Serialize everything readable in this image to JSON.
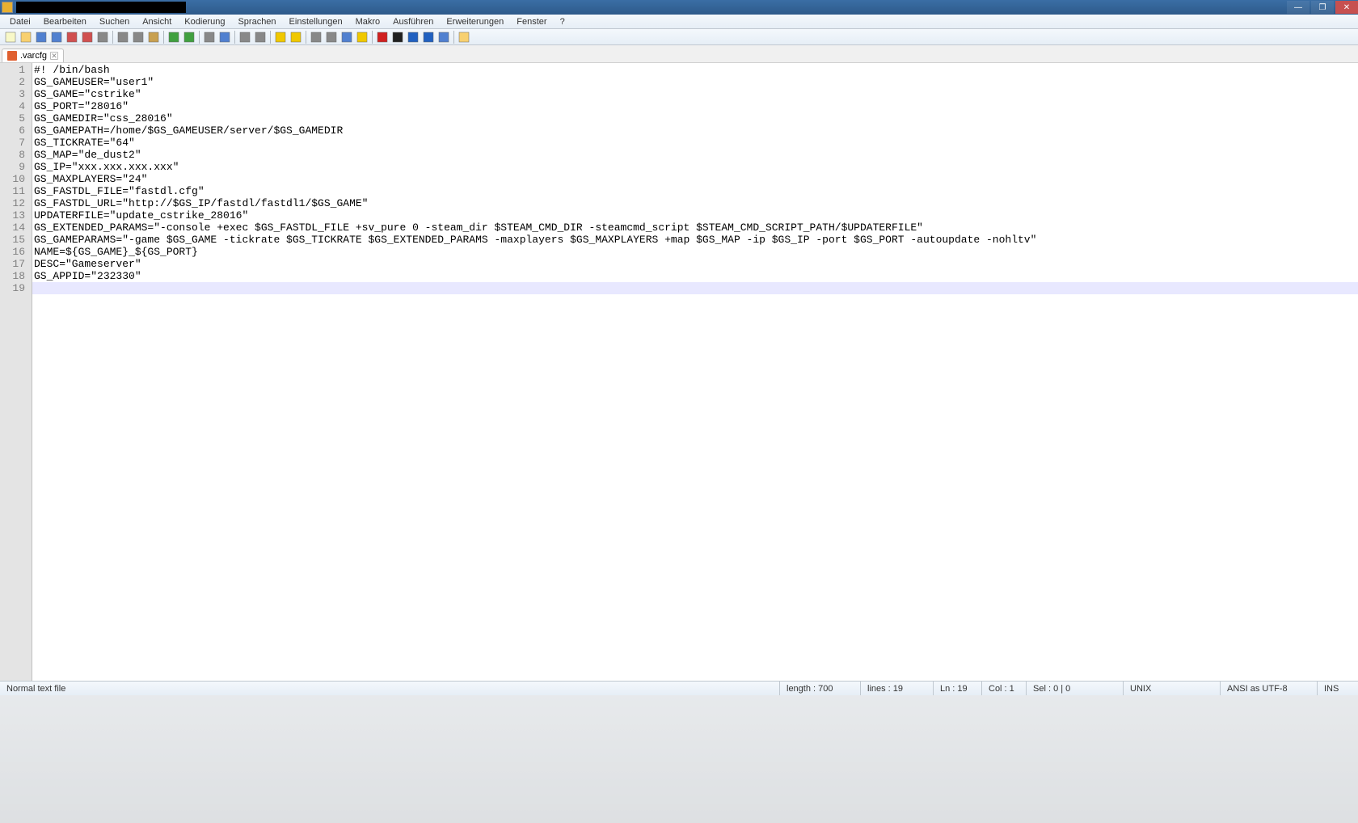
{
  "window": {
    "minimize": "—",
    "maximize": "❐",
    "close": "✕"
  },
  "menu": {
    "items": [
      "Datei",
      "Bearbeiten",
      "Suchen",
      "Ansicht",
      "Kodierung",
      "Sprachen",
      "Einstellungen",
      "Makro",
      "Ausführen",
      "Erweiterungen",
      "Fenster",
      "?"
    ]
  },
  "toolbar": {
    "icons": [
      "new-file-icon",
      "open-file-icon",
      "save-icon",
      "save-all-icon",
      "close-icon",
      "close-all-icon",
      "print-icon",
      "sep",
      "cut-icon",
      "copy-icon",
      "paste-icon",
      "sep",
      "undo-icon",
      "redo-icon",
      "sep",
      "find-icon",
      "replace-icon",
      "sep",
      "zoom-in-icon",
      "zoom-out-icon",
      "sep",
      "sync-v-icon",
      "sync-h-icon",
      "sep",
      "wordwrap-icon",
      "all-chars-icon",
      "indent-icon",
      "lang-icon",
      "sep",
      "record-icon",
      "stop-icon",
      "play-icon",
      "play-multi-icon",
      "save-macro-icon",
      "sep",
      "folder-icon"
    ]
  },
  "tabs": [
    {
      "label": ".varcfg",
      "close": "✕"
    }
  ],
  "code": {
    "lines": [
      "#! /bin/bash",
      "GS_GAMEUSER=\"user1\"",
      "GS_GAME=\"cstrike\"",
      "GS_PORT=\"28016\"",
      "GS_GAMEDIR=\"css_28016\"",
      "GS_GAMEPATH=/home/$GS_GAMEUSER/server/$GS_GAMEDIR",
      "GS_TICKRATE=\"64\"",
      "GS_MAP=\"de_dust2\"",
      "GS_IP=\"xxx.xxx.xxx.xxx\"",
      "GS_MAXPLAYERS=\"24\"",
      "GS_FASTDL_FILE=\"fastdl.cfg\"",
      "GS_FASTDL_URL=\"http://$GS_IP/fastdl/fastdl1/$GS_GAME\"",
      "UPDATERFILE=\"update_cstrike_28016\"",
      "GS_EXTENDED_PARAMS=\"-console +exec $GS_FASTDL_FILE +sv_pure 0 -steam_dir $STEAM_CMD_DIR -steamcmd_script $STEAM_CMD_SCRIPT_PATH/$UPDATERFILE\"",
      "GS_GAMEPARAMS=\"-game $GS_GAME -tickrate $GS_TICKRATE $GS_EXTENDED_PARAMS -maxplayers $GS_MAXPLAYERS +map $GS_MAP -ip $GS_IP -port $GS_PORT -autoupdate -nohltv\"",
      "NAME=${GS_GAME}_${GS_PORT}",
      "DESC=\"Gameserver\"",
      "GS_APPID=\"232330\"",
      ""
    ],
    "current_line_index": 18
  },
  "status": {
    "filetype": "Normal text file",
    "length": "length : 700",
    "lines": "lines : 19",
    "ln": "Ln : 19",
    "col": "Col : 1",
    "sel": "Sel : 0 | 0",
    "eol": "UNIX",
    "encoding": "ANSI as UTF-8",
    "mode": "INS"
  }
}
